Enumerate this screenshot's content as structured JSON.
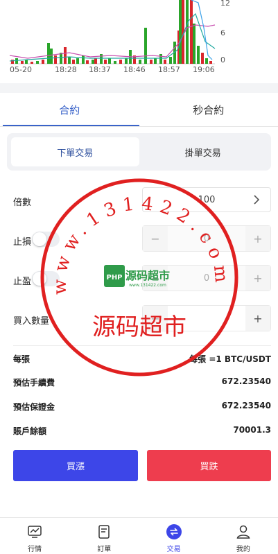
{
  "chart": {
    "x_ticks": [
      "05-20",
      "18:28",
      "18:37",
      "18:46",
      "18:57",
      "19:06"
    ],
    "y_ticks": [
      "12",
      "6",
      "0"
    ]
  },
  "main_tabs": [
    {
      "label": "合約",
      "active": true
    },
    {
      "label": "秒合約",
      "active": false
    }
  ],
  "sub_tabs": [
    {
      "label": "下單交易",
      "active": true
    },
    {
      "label": "掛單交易",
      "active": false
    }
  ],
  "form": {
    "multiplier_label": "倍數",
    "multiplier_value": "100",
    "stop_loss_label": "止損",
    "stop_loss_value": "0",
    "take_profit_label": "止盈",
    "take_profit_value": "0",
    "buy_qty_label": "買入數量",
    "minus": "−",
    "plus": "+"
  },
  "info": {
    "per_contract_label": "每張",
    "per_contract_value": "每張 =1 BTC/USDT",
    "est_fee_label": "預估手續費",
    "est_fee_value": "672.23540",
    "est_margin_label": "預估保證金",
    "est_margin_value": "672.23540",
    "balance_label": "賬戶餘額",
    "balance_value": "70001.3"
  },
  "actions": {
    "buy_label": "買漲",
    "sell_label": "買跌"
  },
  "nav": [
    {
      "label": "行情",
      "icon": "market-icon"
    },
    {
      "label": "訂單",
      "icon": "orders-icon"
    },
    {
      "label": "交易",
      "icon": "trade-icon",
      "active": true
    },
    {
      "label": "我的",
      "icon": "profile-icon"
    }
  ],
  "watermark": {
    "ring_text": "www.131422.com",
    "title": "源码超市",
    "logo_badge": "PHP",
    "logo_title": "源码超市",
    "logo_sub": "www.131422.com"
  },
  "colors": {
    "accent": "#3a63c9",
    "buy": "#3d46e8",
    "sell": "#ee3d4e",
    "candle_up": "#2aa52a",
    "candle_down": "#d9262c",
    "stamp": "#e02020"
  }
}
